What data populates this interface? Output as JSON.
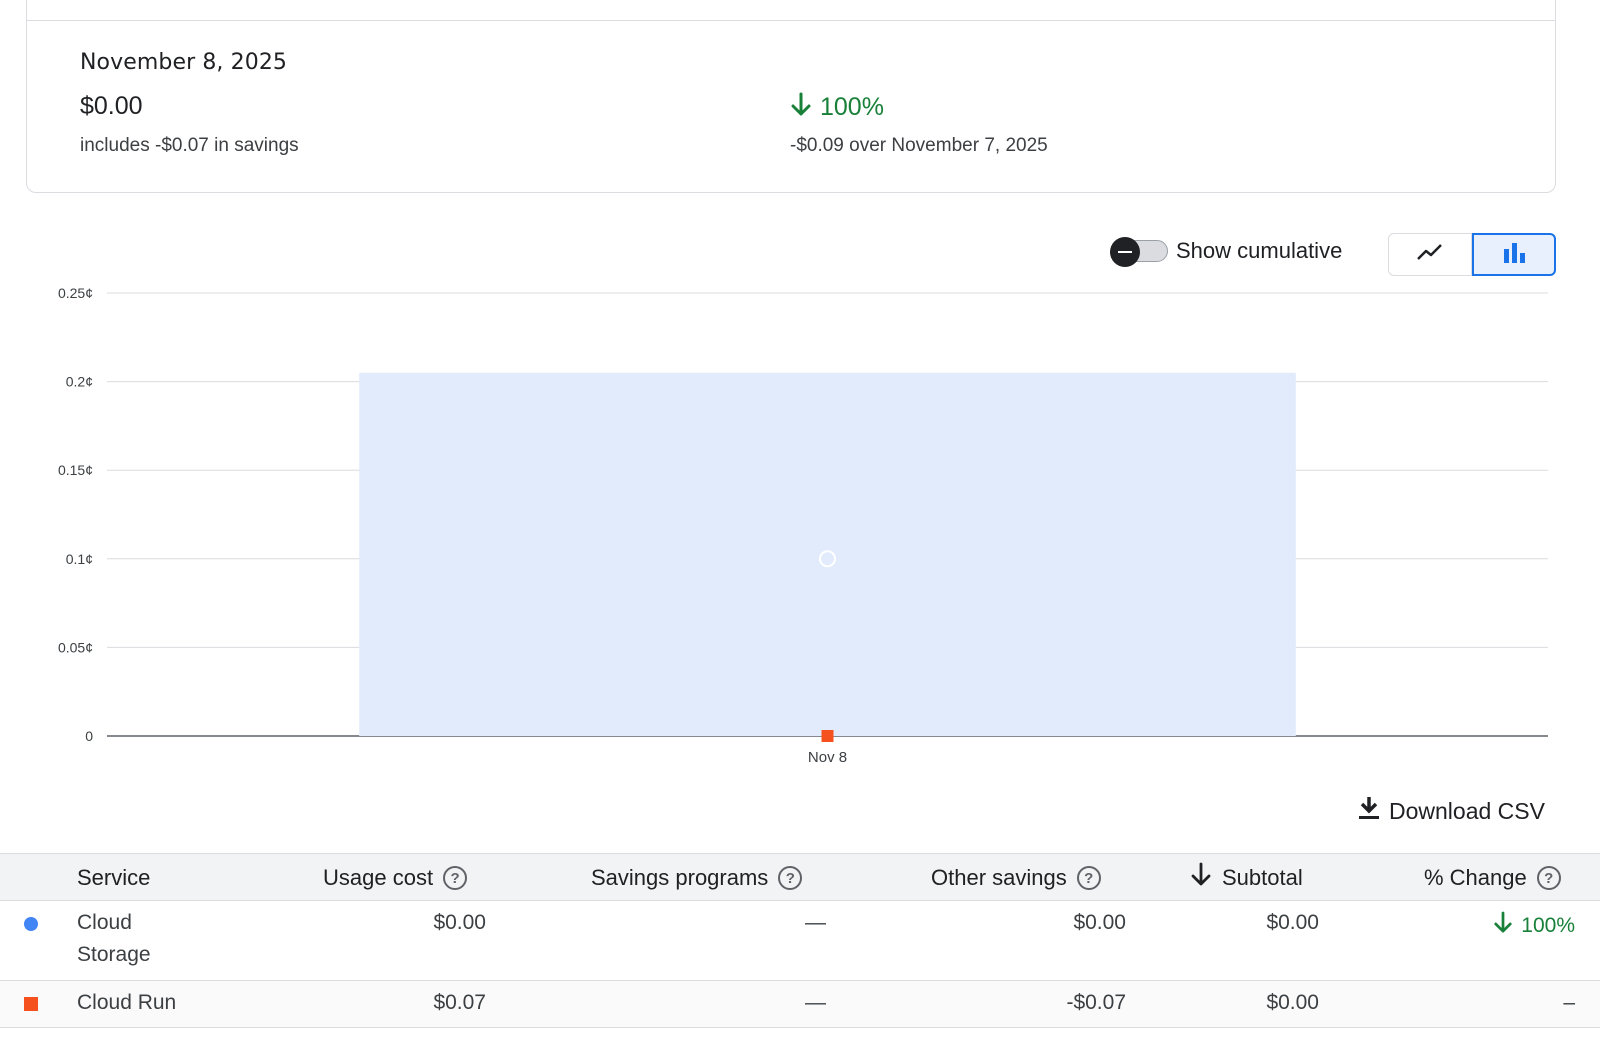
{
  "summary": {
    "date": "November 8, 2025",
    "amount": "$0.00",
    "savings_note": "includes -$0.07 in savings",
    "change_percent": "100%",
    "change_direction": "down",
    "change_note": "-$0.09 over November 7, 2025"
  },
  "controls": {
    "toggle_label": "Show cumulative",
    "toggle_on": false,
    "chart_type_selected": "bar",
    "line_icon": "line-chart-icon",
    "bar_icon": "bar-chart-icon"
  },
  "chart_data": {
    "type": "bar",
    "categories": [
      "Nov 8"
    ],
    "series": [
      {
        "name": "Cloud Storage",
        "color": "#4285f4",
        "values": [
          0.00205
        ],
        "display": "bar"
      },
      {
        "name": "Cloud Run",
        "color": "#f4511e",
        "values": [
          0
        ],
        "display": "marker"
      }
    ],
    "hover_point": {
      "category": "Nov 8",
      "value": 0.001
    },
    "y_ticks": [
      "0",
      "0.05¢",
      "0.1¢",
      "0.15¢",
      "0.2¢",
      "0.25¢"
    ],
    "y_tick_values": [
      0,
      0.0005,
      0.001,
      0.0015,
      0.002,
      0.0025
    ],
    "ylim": [
      0,
      0.0025
    ],
    "grid": true,
    "title": "",
    "xlabel": "",
    "ylabel": ""
  },
  "download": {
    "label": "Download CSV",
    "icon": "download-icon"
  },
  "table": {
    "headers": {
      "service": "Service",
      "usage_cost": "Usage cost",
      "savings_programs": "Savings programs",
      "other_savings": "Other savings",
      "subtotal": "Subtotal",
      "pct_change": "% Change"
    },
    "sort_column": "subtotal",
    "rows": [
      {
        "service_line1": "Cloud",
        "service_line2": "Storage",
        "color": "#4285f4",
        "marker": "circle",
        "usage_cost": "$0.00",
        "savings_programs": "—",
        "other_savings": "$0.00",
        "subtotal": "$0.00",
        "pct_change": "100%",
        "pct_direction": "down"
      },
      {
        "service_line1": "Cloud Run",
        "color": "#f4511e",
        "marker": "square",
        "usage_cost": "$0.07",
        "savings_programs": "—",
        "other_savings": "-$0.07",
        "subtotal": "$0.00",
        "pct_change": "–"
      }
    ]
  }
}
